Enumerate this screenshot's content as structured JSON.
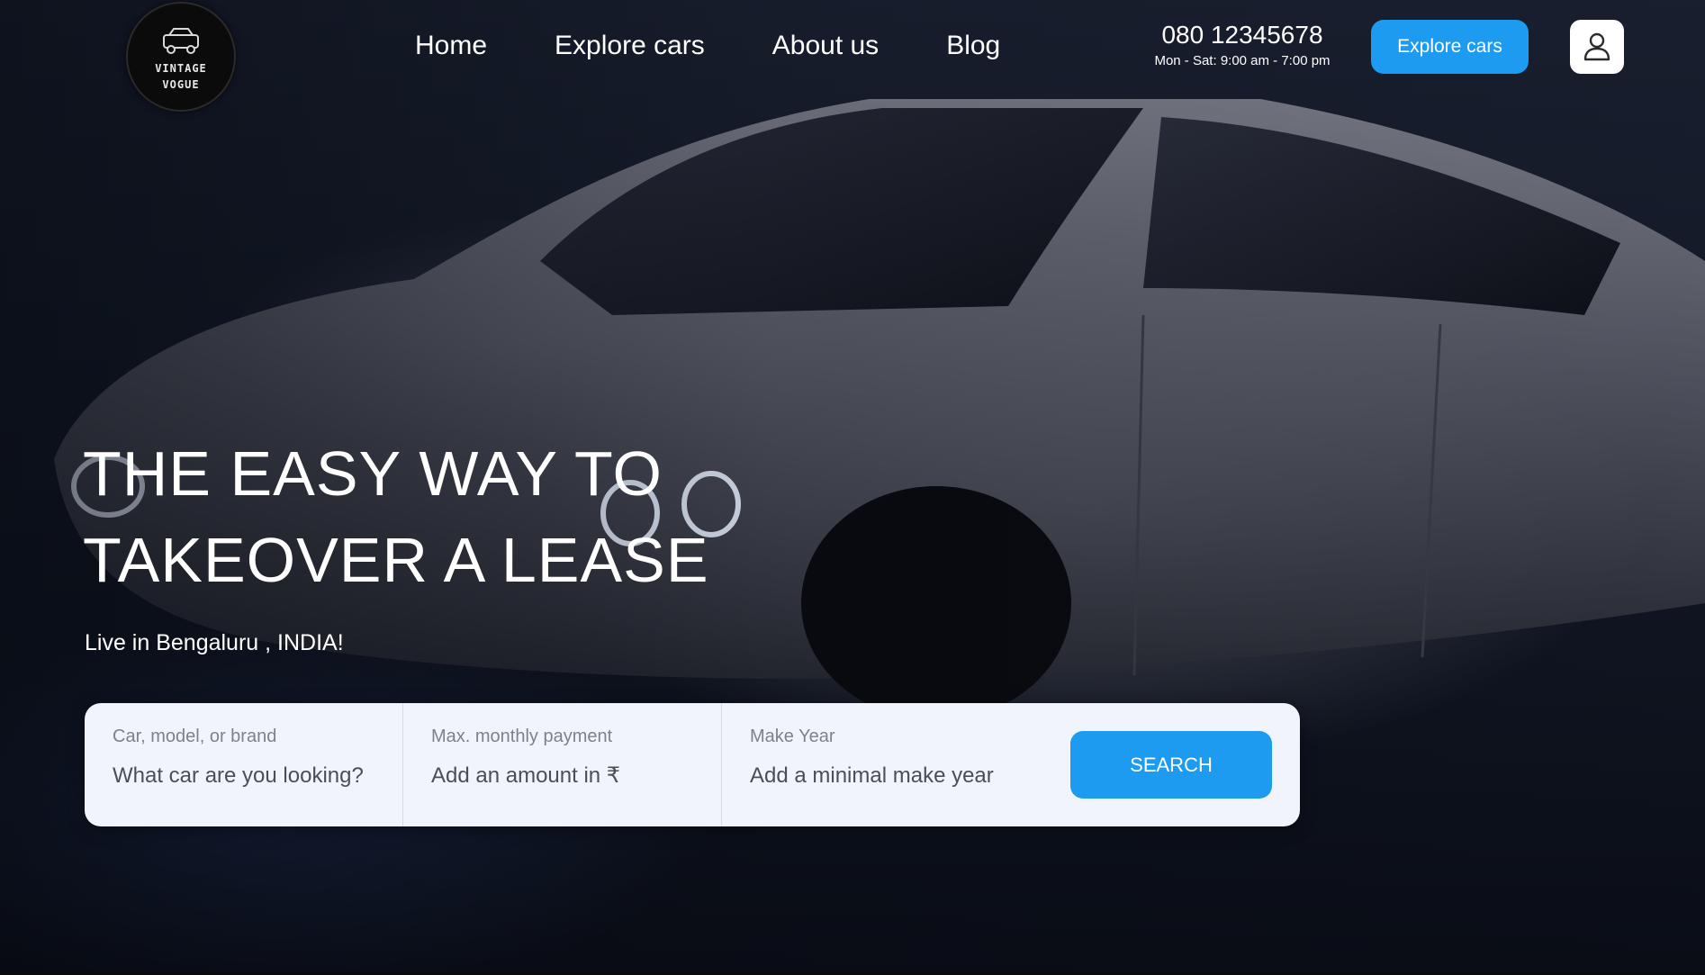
{
  "brand": {
    "logo_text_line1": "VINTAGE",
    "logo_text_line2": "VOGUE"
  },
  "nav": {
    "items": [
      {
        "label": "Home"
      },
      {
        "label": "Explore cars"
      },
      {
        "label": "About us"
      },
      {
        "label": "Blog"
      }
    ]
  },
  "contact": {
    "phone": "080 12345678",
    "hours": "Mon - Sat: 9:00 am - 7:00 pm"
  },
  "header": {
    "cta_label": "Explore cars",
    "user_icon": "user-icon"
  },
  "hero": {
    "headline_line1": "THE EASY WAY TO",
    "headline_line2": "TAKEOVER A LEASE",
    "subline": "Live in Bengaluru , INDIA!"
  },
  "search": {
    "car_label": "Car, model, or brand",
    "car_placeholder": "What car are you looking?",
    "payment_label": "Max. monthly payment",
    "payment_placeholder": "Add an amount in ₹",
    "year_label": "Make Year",
    "year_placeholder": "Add a minimal make year",
    "button_label": "SEARCH"
  },
  "colors": {
    "accent": "#1d9bf0",
    "panel_bg": "#f1f5fb"
  }
}
